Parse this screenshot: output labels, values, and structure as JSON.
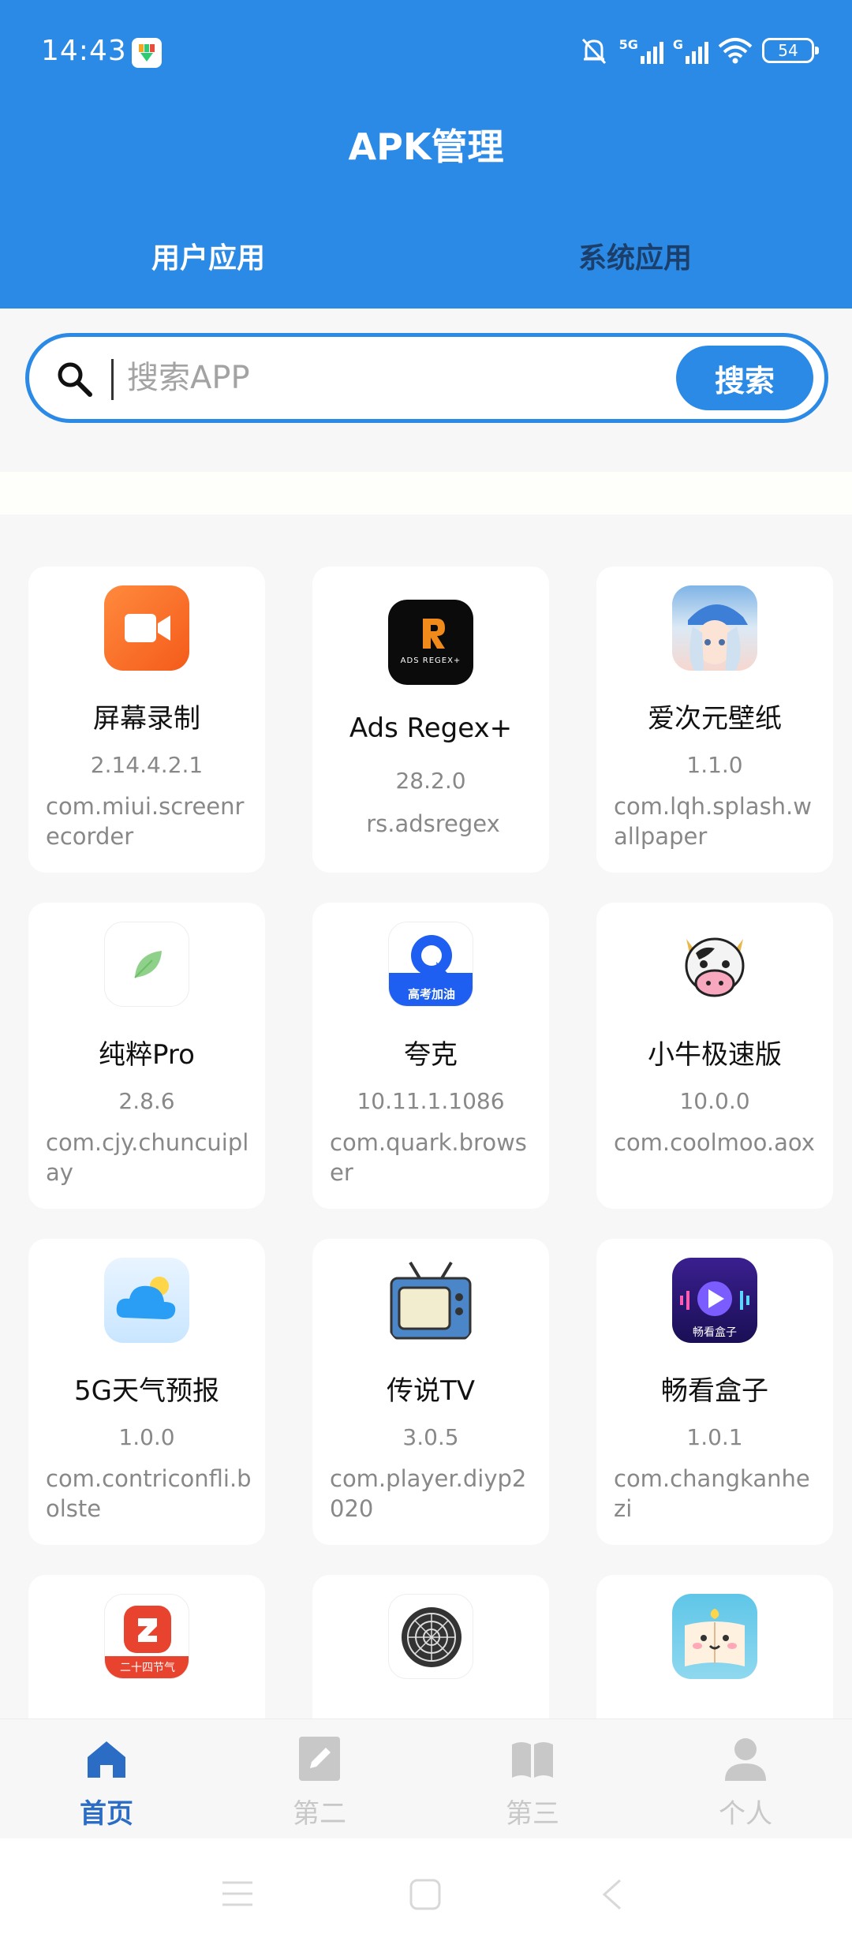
{
  "status": {
    "time": "14:43",
    "signal1": "5G",
    "signal2": "G",
    "battery": "54"
  },
  "header": {
    "title": "APK管理"
  },
  "tabs": [
    {
      "label": "用户应用",
      "active": true
    },
    {
      "label": "系统应用",
      "active": false
    }
  ],
  "search": {
    "placeholder": "搜索APP",
    "button": "搜索"
  },
  "apps": [
    {
      "name": "屏幕录制",
      "version": "2.14.4.2.1",
      "package": "com.miui.screenrecorder",
      "icon": "screen-recorder-icon"
    },
    {
      "name": "Ads Regex+",
      "version": "28.2.0",
      "package": "rs.adsregex",
      "icon": "ads-regex-icon",
      "icon_text": "ADS REGEX+"
    },
    {
      "name": "爱次元壁纸",
      "version": "1.1.0",
      "package": "com.lqh.splash.wallpaper",
      "icon": "wallpaper-girl-icon"
    },
    {
      "name": "纯粹Pro",
      "version": "2.8.6",
      "package": "com.cjy.chuncuiplay",
      "icon": "leaf-icon"
    },
    {
      "name": "夸克",
      "version": "10.11.1.1086",
      "package": "com.quark.browser",
      "icon": "quark-icon",
      "icon_text": "高考加油"
    },
    {
      "name": "小牛极速版",
      "version": "10.0.0",
      "package": "com.coolmoo.aox",
      "icon": "cow-icon"
    },
    {
      "name": "5G天气预报",
      "version": "1.0.0",
      "package": "com.contriconfli.bolste",
      "icon": "weather-cloud-icon"
    },
    {
      "name": "传说TV",
      "version": "3.0.5",
      "package": "com.player.diyp2020",
      "icon": "retro-tv-icon"
    },
    {
      "name": "畅看盒子",
      "version": "1.0.1",
      "package": "com.changkanhezi",
      "icon": "play-box-icon",
      "icon_text": "畅看盒子"
    },
    {
      "name": "",
      "version": "",
      "package": "",
      "icon": "solar-terms-icon",
      "icon_text": "二十四节气"
    },
    {
      "name": "",
      "version": "",
      "package": "",
      "icon": "mandala-icon"
    },
    {
      "name": "",
      "version": "",
      "package": "",
      "icon": "cute-book-icon"
    }
  ],
  "nav": [
    {
      "label": "首页",
      "icon": "home-icon",
      "active": true
    },
    {
      "label": "第二",
      "icon": "edit-doc-icon",
      "active": false
    },
    {
      "label": "第三",
      "icon": "book-icon",
      "active": false
    },
    {
      "label": "个人",
      "icon": "person-icon",
      "active": false
    }
  ],
  "colors": {
    "primary": "#2b8ae6",
    "nav_active": "#2b6cc4",
    "background": "#f7f7f7"
  }
}
